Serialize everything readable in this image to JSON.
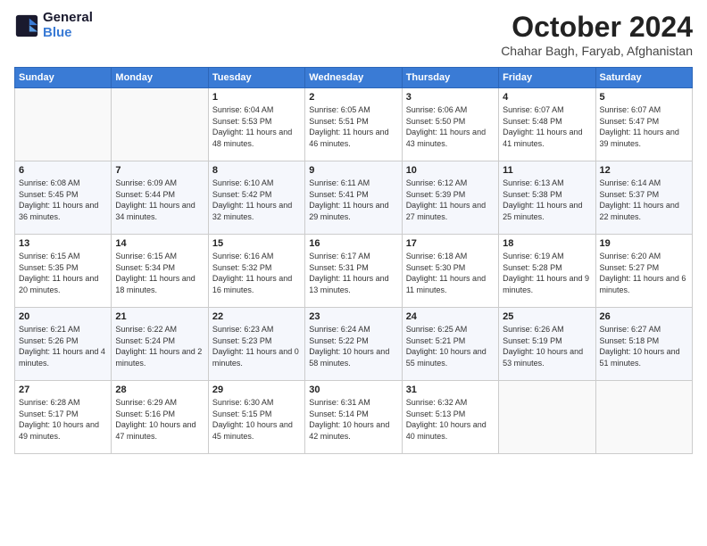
{
  "logo": {
    "line1": "General",
    "line2": "Blue"
  },
  "title": "October 2024",
  "subtitle": "Chahar Bagh, Faryab, Afghanistan",
  "days_of_week": [
    "Sunday",
    "Monday",
    "Tuesday",
    "Wednesday",
    "Thursday",
    "Friday",
    "Saturday"
  ],
  "weeks": [
    [
      {
        "num": "",
        "sunrise": "",
        "sunset": "",
        "daylight": ""
      },
      {
        "num": "",
        "sunrise": "",
        "sunset": "",
        "daylight": ""
      },
      {
        "num": "1",
        "sunrise": "Sunrise: 6:04 AM",
        "sunset": "Sunset: 5:53 PM",
        "daylight": "Daylight: 11 hours and 48 minutes."
      },
      {
        "num": "2",
        "sunrise": "Sunrise: 6:05 AM",
        "sunset": "Sunset: 5:51 PM",
        "daylight": "Daylight: 11 hours and 46 minutes."
      },
      {
        "num": "3",
        "sunrise": "Sunrise: 6:06 AM",
        "sunset": "Sunset: 5:50 PM",
        "daylight": "Daylight: 11 hours and 43 minutes."
      },
      {
        "num": "4",
        "sunrise": "Sunrise: 6:07 AM",
        "sunset": "Sunset: 5:48 PM",
        "daylight": "Daylight: 11 hours and 41 minutes."
      },
      {
        "num": "5",
        "sunrise": "Sunrise: 6:07 AM",
        "sunset": "Sunset: 5:47 PM",
        "daylight": "Daylight: 11 hours and 39 minutes."
      }
    ],
    [
      {
        "num": "6",
        "sunrise": "Sunrise: 6:08 AM",
        "sunset": "Sunset: 5:45 PM",
        "daylight": "Daylight: 11 hours and 36 minutes."
      },
      {
        "num": "7",
        "sunrise": "Sunrise: 6:09 AM",
        "sunset": "Sunset: 5:44 PM",
        "daylight": "Daylight: 11 hours and 34 minutes."
      },
      {
        "num": "8",
        "sunrise": "Sunrise: 6:10 AM",
        "sunset": "Sunset: 5:42 PM",
        "daylight": "Daylight: 11 hours and 32 minutes."
      },
      {
        "num": "9",
        "sunrise": "Sunrise: 6:11 AM",
        "sunset": "Sunset: 5:41 PM",
        "daylight": "Daylight: 11 hours and 29 minutes."
      },
      {
        "num": "10",
        "sunrise": "Sunrise: 6:12 AM",
        "sunset": "Sunset: 5:39 PM",
        "daylight": "Daylight: 11 hours and 27 minutes."
      },
      {
        "num": "11",
        "sunrise": "Sunrise: 6:13 AM",
        "sunset": "Sunset: 5:38 PM",
        "daylight": "Daylight: 11 hours and 25 minutes."
      },
      {
        "num": "12",
        "sunrise": "Sunrise: 6:14 AM",
        "sunset": "Sunset: 5:37 PM",
        "daylight": "Daylight: 11 hours and 22 minutes."
      }
    ],
    [
      {
        "num": "13",
        "sunrise": "Sunrise: 6:15 AM",
        "sunset": "Sunset: 5:35 PM",
        "daylight": "Daylight: 11 hours and 20 minutes."
      },
      {
        "num": "14",
        "sunrise": "Sunrise: 6:15 AM",
        "sunset": "Sunset: 5:34 PM",
        "daylight": "Daylight: 11 hours and 18 minutes."
      },
      {
        "num": "15",
        "sunrise": "Sunrise: 6:16 AM",
        "sunset": "Sunset: 5:32 PM",
        "daylight": "Daylight: 11 hours and 16 minutes."
      },
      {
        "num": "16",
        "sunrise": "Sunrise: 6:17 AM",
        "sunset": "Sunset: 5:31 PM",
        "daylight": "Daylight: 11 hours and 13 minutes."
      },
      {
        "num": "17",
        "sunrise": "Sunrise: 6:18 AM",
        "sunset": "Sunset: 5:30 PM",
        "daylight": "Daylight: 11 hours and 11 minutes."
      },
      {
        "num": "18",
        "sunrise": "Sunrise: 6:19 AM",
        "sunset": "Sunset: 5:28 PM",
        "daylight": "Daylight: 11 hours and 9 minutes."
      },
      {
        "num": "19",
        "sunrise": "Sunrise: 6:20 AM",
        "sunset": "Sunset: 5:27 PM",
        "daylight": "Daylight: 11 hours and 6 minutes."
      }
    ],
    [
      {
        "num": "20",
        "sunrise": "Sunrise: 6:21 AM",
        "sunset": "Sunset: 5:26 PM",
        "daylight": "Daylight: 11 hours and 4 minutes."
      },
      {
        "num": "21",
        "sunrise": "Sunrise: 6:22 AM",
        "sunset": "Sunset: 5:24 PM",
        "daylight": "Daylight: 11 hours and 2 minutes."
      },
      {
        "num": "22",
        "sunrise": "Sunrise: 6:23 AM",
        "sunset": "Sunset: 5:23 PM",
        "daylight": "Daylight: 11 hours and 0 minutes."
      },
      {
        "num": "23",
        "sunrise": "Sunrise: 6:24 AM",
        "sunset": "Sunset: 5:22 PM",
        "daylight": "Daylight: 10 hours and 58 minutes."
      },
      {
        "num": "24",
        "sunrise": "Sunrise: 6:25 AM",
        "sunset": "Sunset: 5:21 PM",
        "daylight": "Daylight: 10 hours and 55 minutes."
      },
      {
        "num": "25",
        "sunrise": "Sunrise: 6:26 AM",
        "sunset": "Sunset: 5:19 PM",
        "daylight": "Daylight: 10 hours and 53 minutes."
      },
      {
        "num": "26",
        "sunrise": "Sunrise: 6:27 AM",
        "sunset": "Sunset: 5:18 PM",
        "daylight": "Daylight: 10 hours and 51 minutes."
      }
    ],
    [
      {
        "num": "27",
        "sunrise": "Sunrise: 6:28 AM",
        "sunset": "Sunset: 5:17 PM",
        "daylight": "Daylight: 10 hours and 49 minutes."
      },
      {
        "num": "28",
        "sunrise": "Sunrise: 6:29 AM",
        "sunset": "Sunset: 5:16 PM",
        "daylight": "Daylight: 10 hours and 47 minutes."
      },
      {
        "num": "29",
        "sunrise": "Sunrise: 6:30 AM",
        "sunset": "Sunset: 5:15 PM",
        "daylight": "Daylight: 10 hours and 45 minutes."
      },
      {
        "num": "30",
        "sunrise": "Sunrise: 6:31 AM",
        "sunset": "Sunset: 5:14 PM",
        "daylight": "Daylight: 10 hours and 42 minutes."
      },
      {
        "num": "31",
        "sunrise": "Sunrise: 6:32 AM",
        "sunset": "Sunset: 5:13 PM",
        "daylight": "Daylight: 10 hours and 40 minutes."
      },
      {
        "num": "",
        "sunrise": "",
        "sunset": "",
        "daylight": ""
      },
      {
        "num": "",
        "sunrise": "",
        "sunset": "",
        "daylight": ""
      }
    ]
  ]
}
